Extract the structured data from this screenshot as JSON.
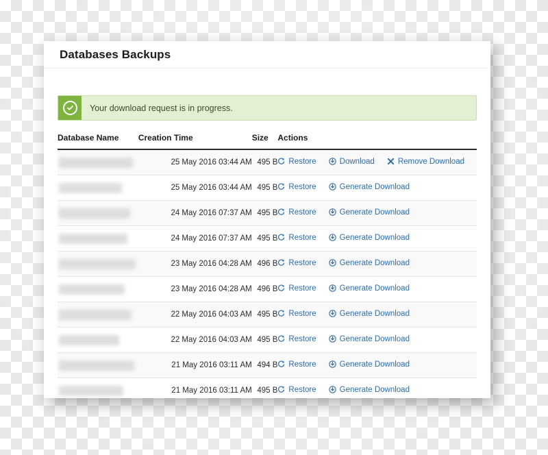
{
  "page": {
    "title": "Databases Backups"
  },
  "alert": {
    "icon": "check-circle-icon",
    "message": "Your download request is in progress.",
    "bg_color": "#e4f0d4",
    "border_color": "#c9e0ab",
    "icon_bg_color": "#7fb441"
  },
  "table": {
    "columns": [
      {
        "key": "dbname",
        "label": "Database Name"
      },
      {
        "key": "created",
        "label": "Creation Time"
      },
      {
        "key": "size",
        "label": "Size"
      },
      {
        "key": "actions",
        "label": "Actions"
      }
    ],
    "link_color": "#2f6ca8",
    "rows": [
      {
        "dbname": "",
        "created": "25 May 2016 03:44 AM",
        "size": "495 B",
        "actions": [
          {
            "label": "Restore",
            "icon": "restore-icon"
          },
          {
            "label": "Download",
            "icon": "download-circle-icon"
          },
          {
            "label": "Remove Download",
            "icon": "remove-x-icon"
          }
        ]
      },
      {
        "dbname": "",
        "created": "25 May 2016 03:44 AM",
        "size": "495 B",
        "actions": [
          {
            "label": "Restore",
            "icon": "restore-icon"
          },
          {
            "label": "Generate Download",
            "icon": "download-circle-icon"
          }
        ]
      },
      {
        "dbname": "",
        "created": "24 May 2016 07:37 AM",
        "size": "495 B",
        "actions": [
          {
            "label": "Restore",
            "icon": "restore-icon"
          },
          {
            "label": "Generate Download",
            "icon": "download-circle-icon"
          }
        ]
      },
      {
        "dbname": "",
        "created": "24 May 2016 07:37 AM",
        "size": "495 B",
        "actions": [
          {
            "label": "Restore",
            "icon": "restore-icon"
          },
          {
            "label": "Generate Download",
            "icon": "download-circle-icon"
          }
        ]
      },
      {
        "dbname": "",
        "created": "23 May 2016 04:28 AM",
        "size": "496 B",
        "actions": [
          {
            "label": "Restore",
            "icon": "restore-icon"
          },
          {
            "label": "Generate Download",
            "icon": "download-circle-icon"
          }
        ]
      },
      {
        "dbname": "",
        "created": "23 May 2016 04:28 AM",
        "size": "496 B",
        "actions": [
          {
            "label": "Restore",
            "icon": "restore-icon"
          },
          {
            "label": "Generate Download",
            "icon": "download-circle-icon"
          }
        ]
      },
      {
        "dbname": "",
        "created": "22 May 2016 04:03 AM",
        "size": "495 B",
        "actions": [
          {
            "label": "Restore",
            "icon": "restore-icon"
          },
          {
            "label": "Generate Download",
            "icon": "download-circle-icon"
          }
        ]
      },
      {
        "dbname": "",
        "created": "22 May 2016 04:03 AM",
        "size": "495 B",
        "actions": [
          {
            "label": "Restore",
            "icon": "restore-icon"
          },
          {
            "label": "Generate Download",
            "icon": "download-circle-icon"
          }
        ]
      },
      {
        "dbname": "",
        "created": "21 May 2016 03:11 AM",
        "size": "494 B",
        "actions": [
          {
            "label": "Restore",
            "icon": "restore-icon"
          },
          {
            "label": "Generate Download",
            "icon": "download-circle-icon"
          }
        ]
      },
      {
        "dbname": "",
        "created": "21 May 2016 03:11 AM",
        "size": "495 B",
        "actions": [
          {
            "label": "Restore",
            "icon": "restore-icon"
          },
          {
            "label": "Generate Download",
            "icon": "download-circle-icon"
          }
        ]
      }
    ]
  },
  "scrollbar": {
    "name": "horizontal-scrollbar"
  }
}
